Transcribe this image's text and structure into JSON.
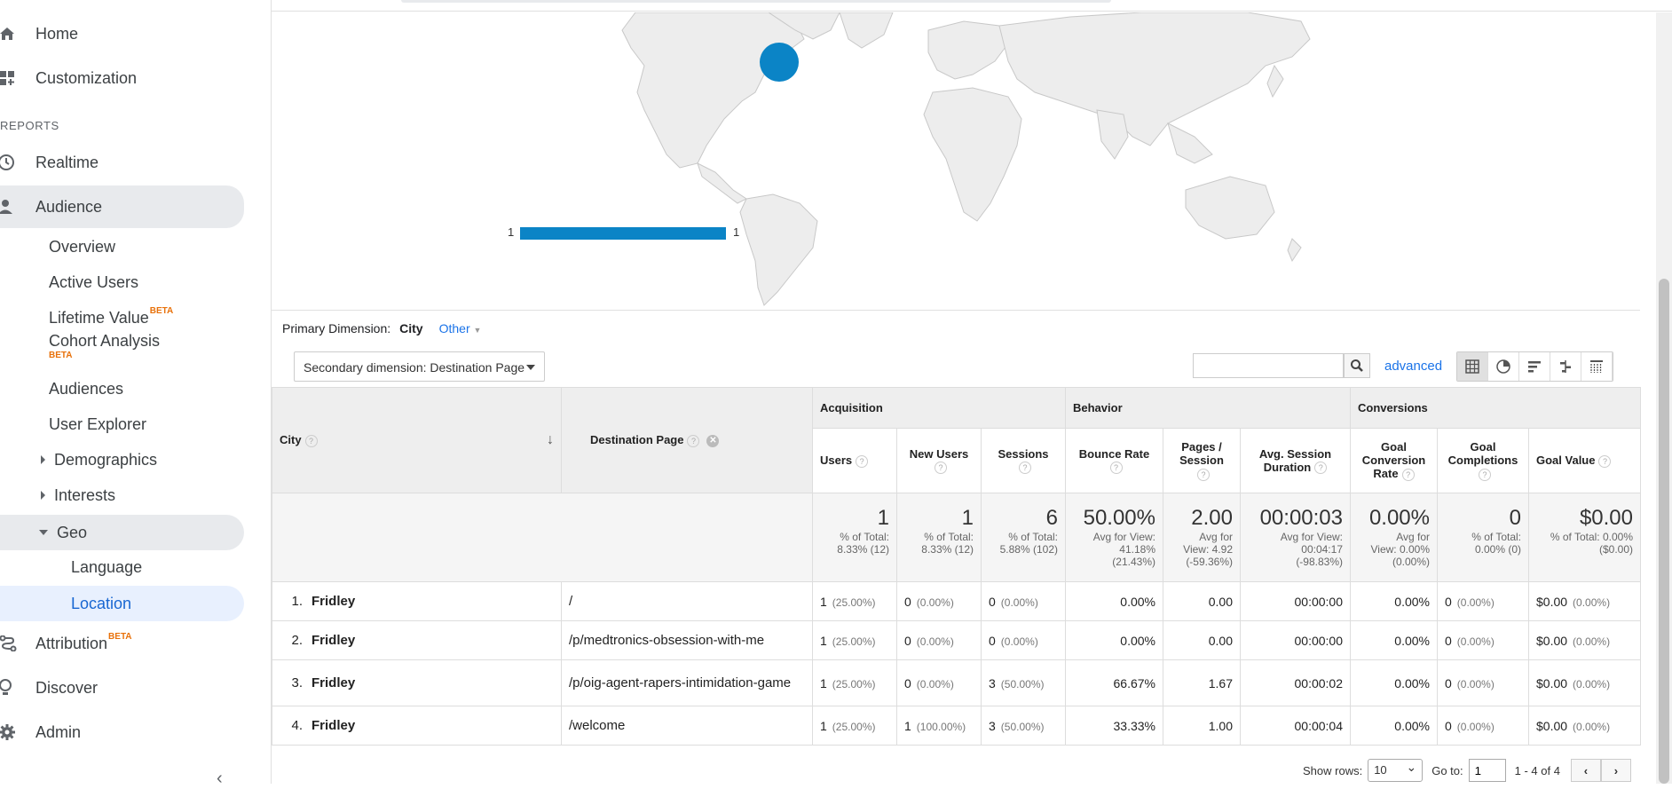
{
  "sidebar": {
    "home": "Home",
    "customization": "Customization",
    "reports_header": "REPORTS",
    "realtime": "Realtime",
    "audience": "Audience",
    "audience_items": {
      "overview": "Overview",
      "active_users": "Active Users",
      "lifetime_value": "Lifetime Value",
      "lifetime_beta": "BETA",
      "cohort": "Cohort Analysis",
      "cohort_beta": "BETA",
      "audiences": "Audiences",
      "user_explorer": "User Explorer",
      "demographics": "Demographics",
      "interests": "Interests",
      "geo": "Geo",
      "language": "Language",
      "location": "Location"
    },
    "attribution": "Attribution",
    "attribution_beta": "BETA",
    "discover": "Discover",
    "admin": "Admin",
    "collapse": "‹"
  },
  "map": {
    "legend_min": "1",
    "legend_max": "1",
    "bubble_color": "#0b84c6",
    "legend_color": "#0b84c6"
  },
  "dimension": {
    "label": "Primary Dimension:",
    "current": "City",
    "other": "Other"
  },
  "secondary": {
    "label": "Secondary dimension: Destination Page"
  },
  "search": {
    "placeholder": "",
    "advanced": "advanced"
  },
  "table": {
    "groups": {
      "acquisition": "Acquisition",
      "behavior": "Behavior",
      "conversions": "Conversions"
    },
    "headers": {
      "city": "City",
      "dest": "Destination Page",
      "users": "Users",
      "new_users": "New Users",
      "sessions": "Sessions",
      "bounce": "Bounce Rate",
      "pages": "Pages / Session",
      "duration": "Avg. Session Duration",
      "goal_conv": "Goal Conversion Rate",
      "goal_comp": "Goal Completions",
      "goal_val": "Goal Value"
    },
    "totals": {
      "users": {
        "v": "1",
        "s1": "% of Total:",
        "s2": "8.33% (12)"
      },
      "new_users": {
        "v": "1",
        "s1": "% of Total:",
        "s2": "8.33% (12)"
      },
      "sessions": {
        "v": "6",
        "s1": "% of Total:",
        "s2": "5.88% (102)"
      },
      "bounce": {
        "v": "50.00%",
        "s1": "Avg for View:",
        "s2": "41.18%",
        "s3": "(21.43%)"
      },
      "pages": {
        "v": "2.00",
        "s1": "Avg for",
        "s2": "View: 4.92",
        "s3": "(-59.36%)"
      },
      "duration": {
        "v": "00:00:03",
        "s1": "Avg for View:",
        "s2": "00:04:17",
        "s3": "(-98.83%)"
      },
      "goal_conv": {
        "v": "0.00%",
        "s1": "Avg for",
        "s2": "View: 0.00%",
        "s3": "(0.00%)"
      },
      "goal_comp": {
        "v": "0",
        "s1": "% of Total:",
        "s2": "0.00% (0)"
      },
      "goal_val": {
        "v": "$0.00",
        "s1": "% of Total: 0.00%",
        "s2": "($0.00)"
      }
    },
    "rows": [
      {
        "idx": "1.",
        "city": "Fridley",
        "page": "/",
        "users": "1",
        "users_p": "(25.00%)",
        "new": "0",
        "new_p": "(0.00%)",
        "sess": "0",
        "sess_p": "(0.00%)",
        "bounce": "0.00%",
        "pages": "0.00",
        "dur": "00:00:00",
        "gcr": "0.00%",
        "gc": "0",
        "gc_p": "(0.00%)",
        "gv": "$0.00",
        "gv_p": "(0.00%)"
      },
      {
        "idx": "2.",
        "city": "Fridley",
        "page": "/p/medtronics-obsession-with-me",
        "users": "1",
        "users_p": "(25.00%)",
        "new": "0",
        "new_p": "(0.00%)",
        "sess": "0",
        "sess_p": "(0.00%)",
        "bounce": "0.00%",
        "pages": "0.00",
        "dur": "00:00:00",
        "gcr": "0.00%",
        "gc": "0",
        "gc_p": "(0.00%)",
        "gv": "$0.00",
        "gv_p": "(0.00%)"
      },
      {
        "idx": "3.",
        "city": "Fridley",
        "page": "/p/oig-agent-rapers-intimidation-game",
        "users": "1",
        "users_p": "(25.00%)",
        "new": "0",
        "new_p": "(0.00%)",
        "sess": "3",
        "sess_p": "(50.00%)",
        "bounce": "66.67%",
        "pages": "1.67",
        "dur": "00:00:02",
        "gcr": "0.00%",
        "gc": "0",
        "gc_p": "(0.00%)",
        "gv": "$0.00",
        "gv_p": "(0.00%)"
      },
      {
        "idx": "4.",
        "city": "Fridley",
        "page": "/welcome",
        "users": "1",
        "users_p": "(25.00%)",
        "new": "1",
        "new_p": "(100.00%)",
        "sess": "3",
        "sess_p": "(50.00%)",
        "bounce": "33.33%",
        "pages": "1.00",
        "dur": "00:00:04",
        "gcr": "0.00%",
        "gc": "0",
        "gc_p": "(0.00%)",
        "gv": "$0.00",
        "gv_p": "(0.00%)"
      }
    ]
  },
  "pager": {
    "show_rows": "Show rows:",
    "rows_value": "10",
    "goto": "Go to:",
    "goto_value": "1",
    "range": "1 - 4 of 4"
  }
}
